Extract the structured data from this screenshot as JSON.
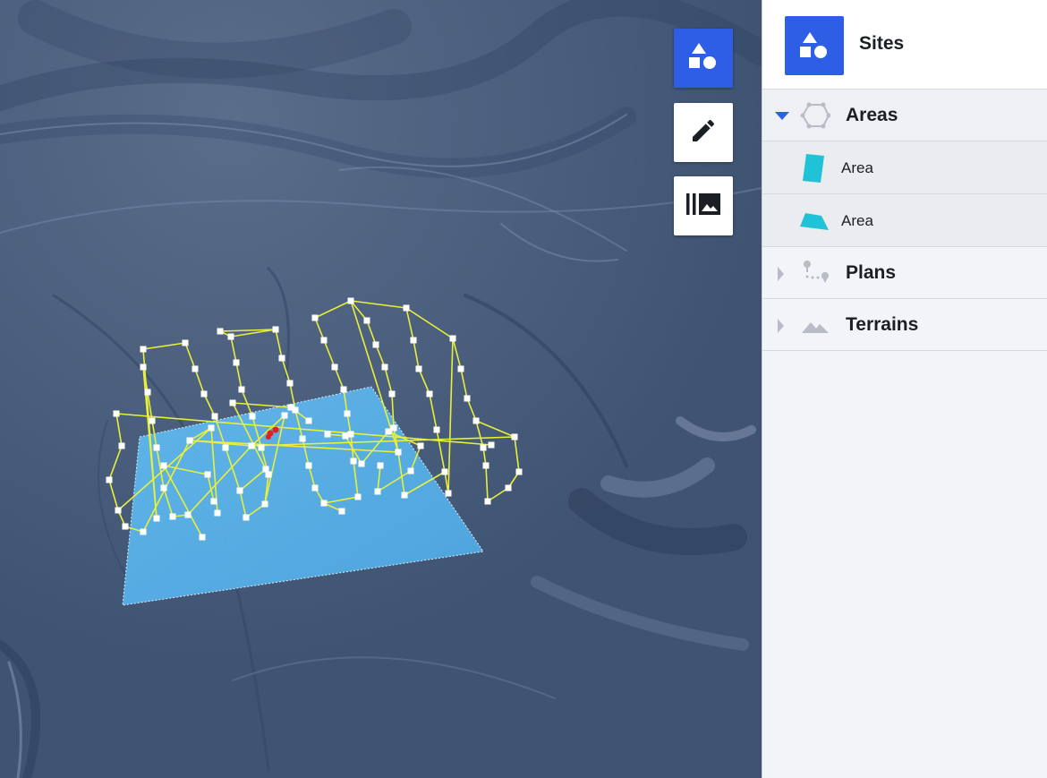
{
  "colors": {
    "accent": "#2f5ee6",
    "area_fill": "#5fb6ea",
    "flight_path": "#e8f03a",
    "waypoint": "#ffffff",
    "home_point": "#e22020",
    "area_icon": "#1fc2d6"
  },
  "map": {
    "terrain_layer": "hillshade-terrain"
  },
  "toolbar": {
    "buttons": [
      {
        "name": "sites-shapes-button",
        "icon": "shapes-icon"
      },
      {
        "name": "edit-button",
        "icon": "pencil-icon"
      },
      {
        "name": "gallery-button",
        "icon": "photo-library-icon"
      }
    ]
  },
  "panel": {
    "title": "Sites",
    "groups": [
      {
        "label": "Areas",
        "icon": "polygon-icon",
        "expanded": true,
        "children": [
          {
            "label": "Area",
            "icon": "area-shape-icon"
          },
          {
            "label": "Area",
            "icon": "area-shape-icon"
          }
        ]
      },
      {
        "label": "Plans",
        "icon": "route-icon",
        "expanded": false
      },
      {
        "label": "Terrains",
        "icon": "mountains-icon",
        "expanded": false
      }
    ]
  }
}
